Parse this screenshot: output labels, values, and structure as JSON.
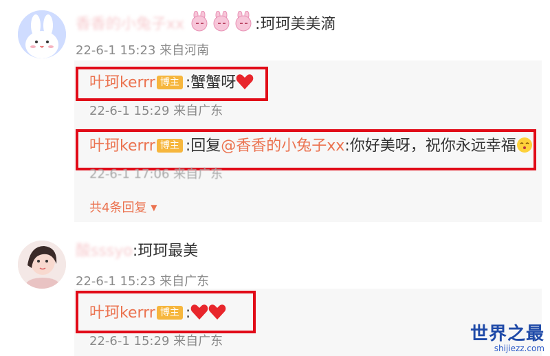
{
  "comments": [
    {
      "author_blurred": "香香的小兔子xx",
      "text": ":珂珂美美滴",
      "time": "22-6-1 15:23",
      "location": "来自河南",
      "replies": [
        {
          "author": "叶珂kerrr",
          "badge": "博主",
          "text": ":蟹蟹呀",
          "time": "22-6-1 15:29",
          "location": "来自广东"
        },
        {
          "author": "叶珂kerrr",
          "badge": "博主",
          "reply_prefix": ":回复",
          "mention": "@香香的小兔子xx",
          "text": ":你好美呀，祝你永远幸福",
          "time": "22-6-1 17:06",
          "location": "来自广东"
        }
      ],
      "more_replies": "共4条回复"
    },
    {
      "author_blurred": "酸sssyo",
      "text": ":珂珂最美",
      "time": "22-6-1 15:23",
      "location": "来自广东",
      "replies": [
        {
          "author": "叶珂kerrr",
          "badge": "博主",
          "text": ":",
          "time": "22-6-1 15:29",
          "location": "来自广东"
        }
      ]
    }
  ],
  "watermark": {
    "title": "世界之最",
    "url": "shijiezz.com"
  },
  "colors": {
    "author": "#eb7350",
    "highlight": "#e10b18",
    "badge": "#f6b63d",
    "watermark": "#1f4aa8"
  }
}
